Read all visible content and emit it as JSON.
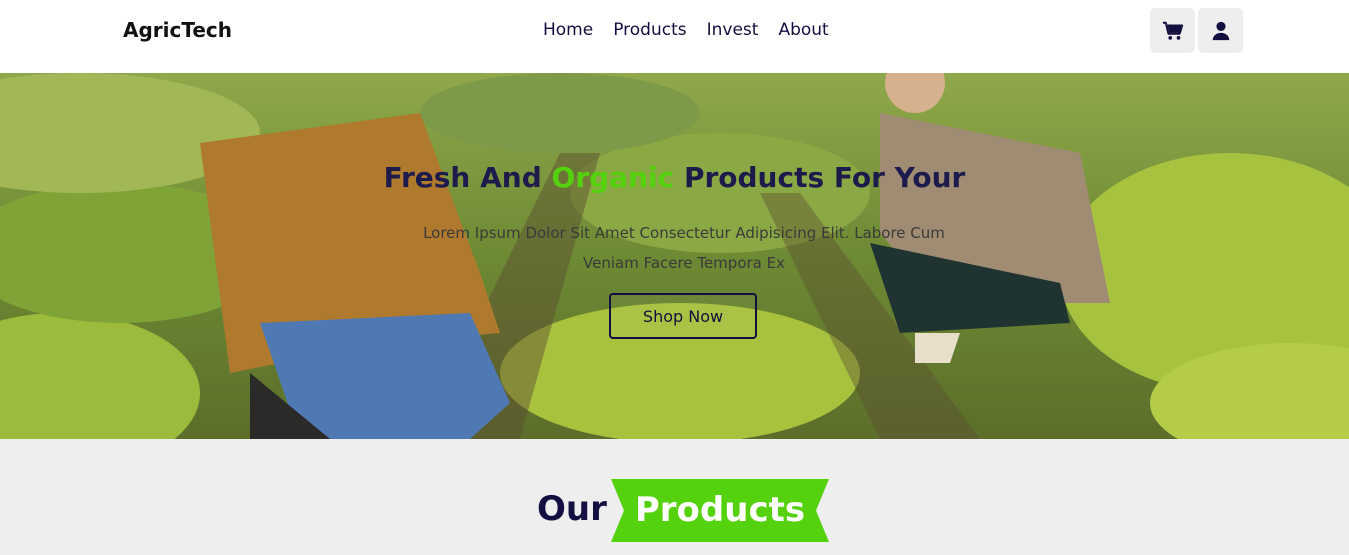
{
  "header": {
    "logo": "AgricTech",
    "nav": [
      "Home",
      "Products",
      "Invest",
      "About"
    ],
    "icons": {
      "cart": "cart-icon",
      "user": "user-icon"
    }
  },
  "hero": {
    "title_part1": "Fresh And ",
    "title_accent": "Organic",
    "title_part2": " Products For Your",
    "subtitle": "Lorem Ipsum Dolor Sit Amet Consectetur Adipisicing Elit. Labore Cum Veniam Facere Tempora Ex",
    "cta": "Shop Now",
    "accent_color": "#55d20e"
  },
  "products_section": {
    "heading_plain": "Our",
    "heading_tag": "Products",
    "tag_color": "#55d20e"
  }
}
